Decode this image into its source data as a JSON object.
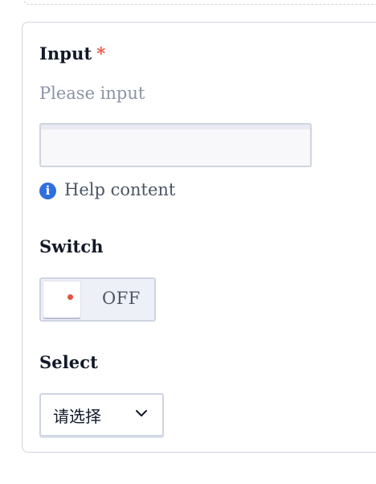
{
  "form": {
    "input": {
      "label": "Input",
      "required_mark": "*",
      "hint": "Please input",
      "value": "",
      "help_icon": "info-icon",
      "help_text": "Help content"
    },
    "switch": {
      "label": "Switch",
      "state_text": "OFF",
      "checked": false
    },
    "select": {
      "label": "Select",
      "selected_value": "请选择",
      "icon": "chevron-down-icon"
    }
  },
  "colors": {
    "required": "#e5533d",
    "info": "#2f6fdf",
    "hint": "#8b93a6"
  }
}
